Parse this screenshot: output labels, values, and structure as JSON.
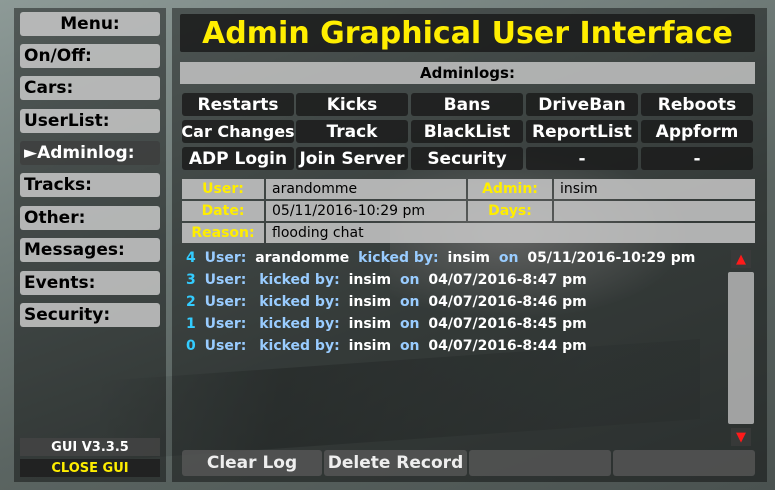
{
  "menu": {
    "title": "Menu:",
    "items": [
      {
        "label": "On/Off:"
      },
      {
        "label": "Cars:"
      },
      {
        "label": "UserList:"
      },
      {
        "label": "►Adminlog:"
      },
      {
        "label": "Tracks:"
      },
      {
        "label": "Other:"
      },
      {
        "label": "Messages:"
      },
      {
        "label": "Events:"
      },
      {
        "label": "Security:"
      }
    ],
    "version": "GUI V3.3.5",
    "close": "CLOSE GUI"
  },
  "header": {
    "title": "Admin Graphical User Interface",
    "section": "Adminlogs:"
  },
  "categories": [
    [
      "Restarts",
      "Kicks",
      "Bans",
      "DriveBan",
      "Reboots"
    ],
    [
      "Car Changes",
      "Track",
      "BlackList",
      "ReportList",
      "Appform"
    ],
    [
      "ADP Login",
      "Join Server",
      "Security",
      "-",
      "-"
    ]
  ],
  "detail": {
    "user_label": "User:",
    "user_value": "arandomme",
    "admin_label": "Admin:",
    "admin_value": "insim",
    "date_label": "Date:",
    "date_value": "05/11/2016-10:29 pm",
    "days_label": "Days:",
    "days_value": "",
    "reason_label": "Reason:",
    "reason_value": "flooding chat"
  },
  "log": [
    {
      "num": "4",
      "user_label": "User:",
      "user": "arandomme",
      "action": "kicked by:",
      "admin": "insim",
      "on": "on",
      "date": "05/11/2016-10:29 pm"
    },
    {
      "num": "3",
      "user_label": "User:",
      "user": "",
      "action": "kicked by:",
      "admin": "insim",
      "on": "on",
      "date": "04/07/2016-8:47 pm"
    },
    {
      "num": "2",
      "user_label": "User:",
      "user": "",
      "action": "kicked by:",
      "admin": "insim",
      "on": "on",
      "date": "04/07/2016-8:46 pm"
    },
    {
      "num": "1",
      "user_label": "User:",
      "user": "",
      "action": "kicked by:",
      "admin": "insim",
      "on": "on",
      "date": "04/07/2016-8:45 pm"
    },
    {
      "num": "0",
      "user_label": "User:",
      "user": "",
      "action": "kicked by:",
      "admin": "insim",
      "on": "on",
      "date": "04/07/2016-8:44 pm"
    }
  ],
  "scroll": {
    "up": "▲",
    "down": "▼"
  },
  "bottom": {
    "clear": "Clear Log",
    "delete": "Delete Record"
  },
  "colors": {
    "title": "#ffee00",
    "accent": "#33ccff",
    "arrow": "#ff1a1a"
  }
}
